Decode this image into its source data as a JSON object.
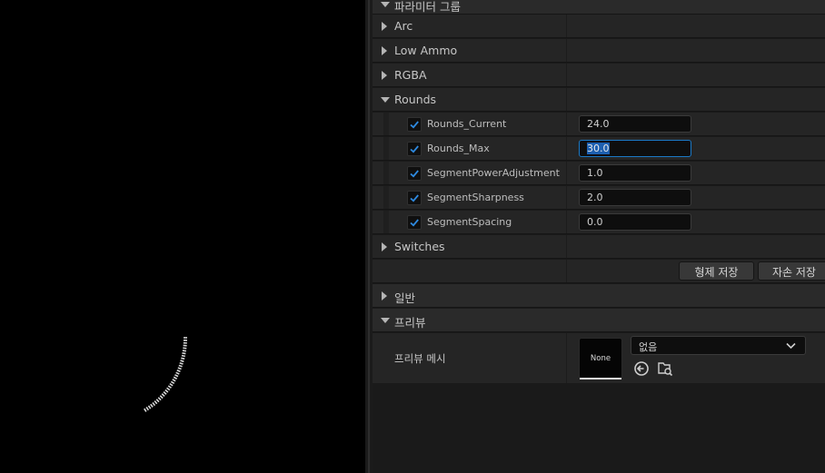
{
  "panel": {
    "top_category": "파라미터 그룹",
    "groups": [
      "Arc",
      "Low Ammo",
      "RGBA",
      "Rounds"
    ],
    "rounds_props": [
      {
        "name": "Rounds_Current",
        "value": "24.0",
        "checked": true
      },
      {
        "name": "Rounds_Max",
        "value": "30.0",
        "checked": true
      },
      {
        "name": "SegmentPowerAdjustment",
        "value": "1.0",
        "checked": true
      },
      {
        "name": "SegmentSharpness",
        "value": "2.0",
        "checked": true
      },
      {
        "name": "SegmentSpacing",
        "value": "0.0",
        "checked": true
      }
    ],
    "switches_label": "Switches",
    "save_sibling_label": "형제 저장",
    "save_child_label": "자손 저장",
    "general_label": "일반",
    "preview_label": "프리뷰",
    "preview_mesh_label": "프리뷰 메시",
    "thumbnail_text": "None",
    "mesh_combo_value": "없음"
  },
  "colors": {
    "accent_focus": "#1b79c6",
    "selection": "#1d5fb0",
    "checkbox_check": "#2e8ae0"
  },
  "viewport": {
    "preview_ring_icon": "segmented-arc-gauge",
    "arc_fill_fraction": 0.8
  }
}
